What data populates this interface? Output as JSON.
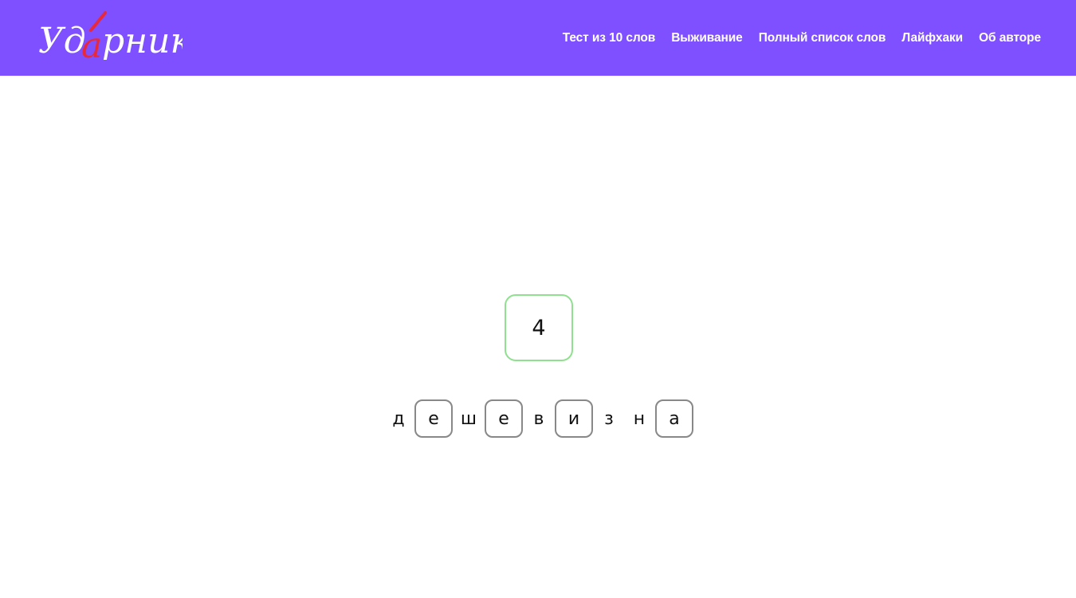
{
  "app": {
    "logo_text": "Ударник"
  },
  "nav": {
    "items": [
      {
        "label": "Тест из 10 слов"
      },
      {
        "label": "Выживание"
      },
      {
        "label": "Полный список слов"
      },
      {
        "label": "Лайфхаки"
      },
      {
        "label": "Об авторе"
      }
    ]
  },
  "game": {
    "score": "4",
    "word": {
      "letters": [
        "д",
        "е",
        "ш",
        "е",
        "в",
        "и",
        "з",
        "н",
        "а"
      ]
    }
  },
  "colors": {
    "header_bg": "#7f50ff",
    "logo_accent": "#e8293b",
    "score_border": "#8fe08f",
    "letter_border": "#888888"
  },
  "icons": {
    "logo": "stress-mark-logo"
  }
}
